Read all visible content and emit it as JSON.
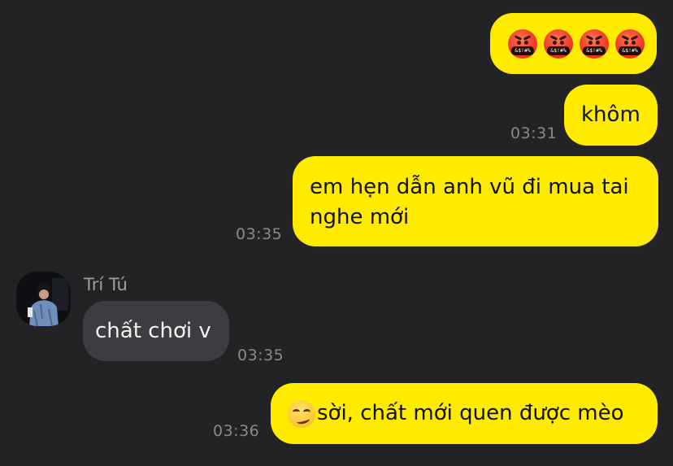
{
  "colors": {
    "background": "#232325",
    "outgoing_bubble": "#FEEB00",
    "incoming_bubble": "#3D3D41",
    "timestamp": "#8A8A8E",
    "sender_name": "#A0A0A4"
  },
  "messages": [
    {
      "direction": "outgoing",
      "content_type": "emoji",
      "emoji": "face-with-symbols-on-mouth",
      "count": 4,
      "symbol_text": "&$!#%",
      "time": ""
    },
    {
      "direction": "outgoing",
      "text": "khôm",
      "time": "03:31"
    },
    {
      "direction": "outgoing",
      "text_lines": [
        "em hẹn dẫn anh vũ đi mua tai",
        "nghe mới"
      ],
      "time": "03:35"
    },
    {
      "direction": "incoming",
      "sender": "Trí Tú",
      "avatar": "profile-photo",
      "text": "chất chơi v",
      "time": "03:35"
    },
    {
      "direction": "outgoing",
      "emoji": "smirking-face",
      "text": "sời, chất mới quen được mèo",
      "time": "03:36"
    }
  ]
}
